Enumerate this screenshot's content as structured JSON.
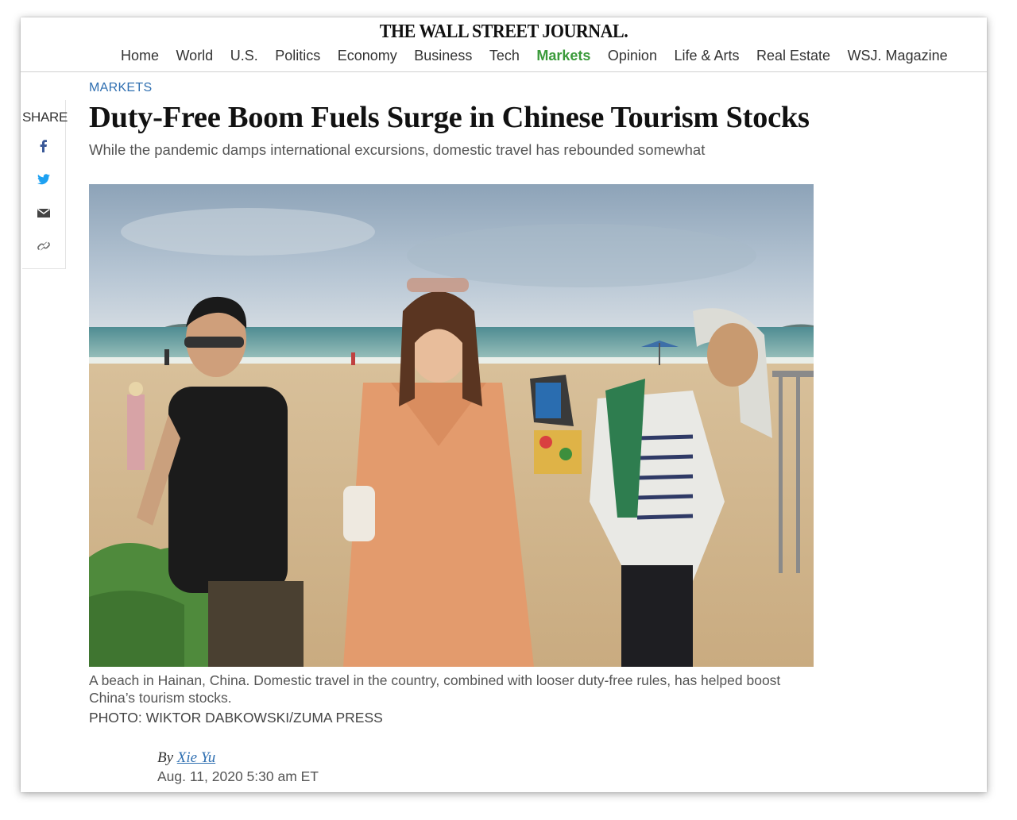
{
  "masthead": {
    "logo": "THE WALL STREET JOURNAL.",
    "nav": [
      "Home",
      "World",
      "U.S.",
      "Politics",
      "Economy",
      "Business",
      "Tech",
      "Markets",
      "Opinion",
      "Life & Arts",
      "Real Estate",
      "WSJ. Magazine"
    ],
    "active_nav": "Markets"
  },
  "share": {
    "label": "SHARE",
    "icons": [
      "facebook-icon",
      "twitter-icon",
      "email-icon",
      "link-icon"
    ]
  },
  "article": {
    "section": "MARKETS",
    "headline": "Duty-Free Boom Fuels Surge in Chinese Tourism Stocks",
    "subhead": "While the pandemic damps international excursions, domestic travel has rebounded somewhat",
    "caption": "A beach in Hainan, China. Domestic travel in the country, combined with looser duty-free rules, has helped boost China’s tourism stocks.",
    "credit": "PHOTO: WIKTOR DABKOWSKI/ZUMA PRESS",
    "byline_prefix": "By",
    "author": "Xie Yu",
    "date": "Aug. 11, 2020 5:30 am ET"
  },
  "colors": {
    "accent_green": "#3a9a3a",
    "link_blue": "#2f6fb1",
    "facebook": "#3b5998",
    "twitter": "#1da1f2"
  }
}
